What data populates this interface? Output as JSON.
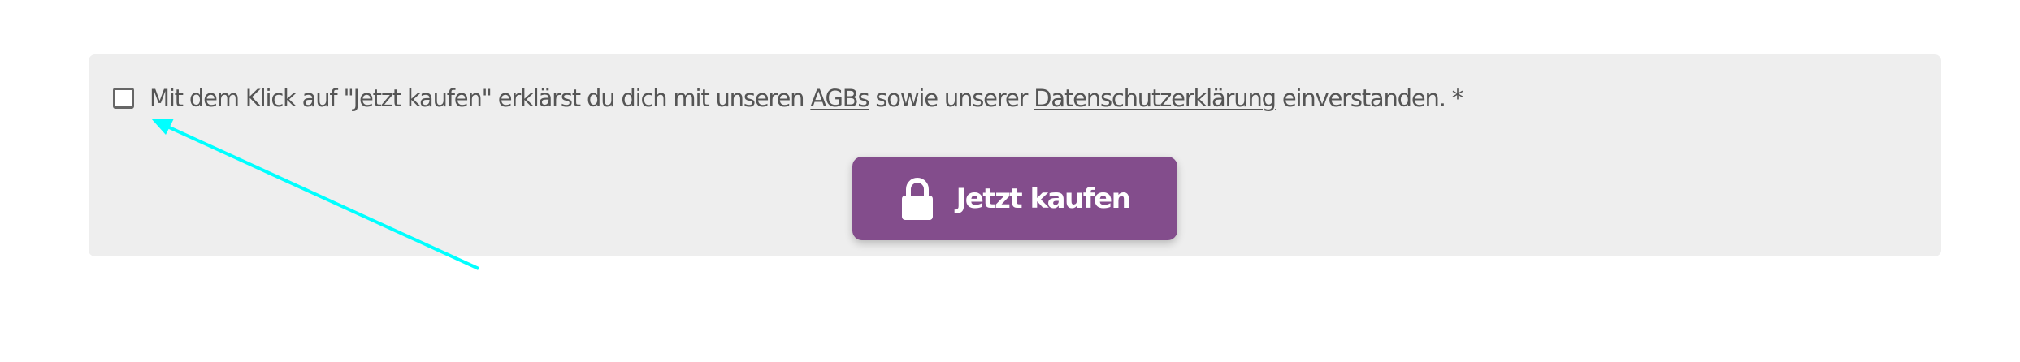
{
  "consent": {
    "text_before": "Mit dem Klick auf \"Jetzt kaufen\" erklärst du dich mit unseren ",
    "terms_link": "AGBs",
    "text_middle": " sowie unserer ",
    "privacy_link": "Datenschutzerklärung",
    "text_after": " einverstanden. *",
    "checked": false
  },
  "buy_button": {
    "label": "Jetzt kaufen",
    "icon": "lock-icon"
  },
  "colors": {
    "panel_background": "#eeeeee",
    "button_background": "#834d8c",
    "text": "#555555",
    "annotation_arrow": "#00ffff"
  }
}
